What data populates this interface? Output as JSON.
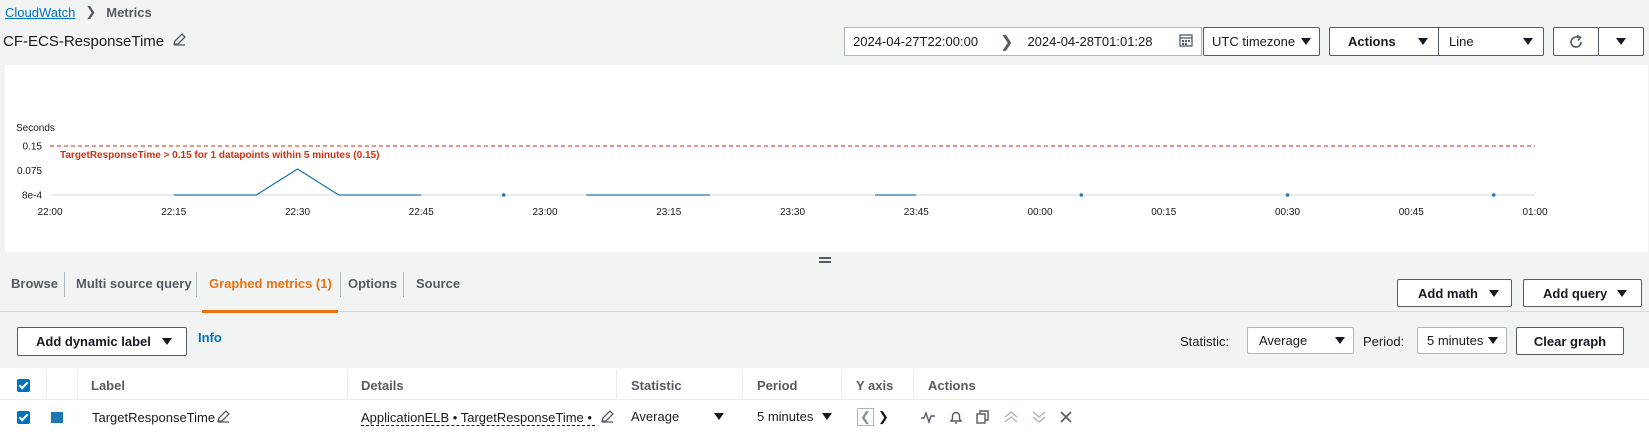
{
  "breadcrumb": {
    "root": "CloudWatch",
    "current": "Metrics"
  },
  "page_title": "CF-ECS-ResponseTime",
  "time_range": {
    "start": "2024-04-27T22:00:00",
    "end": "2024-04-28T01:01:28"
  },
  "toolbar": {
    "timezone": "UTC timezone",
    "actions": "Actions",
    "chart_type": "Line"
  },
  "chart_data": {
    "type": "line",
    "ylabel": "Seconds",
    "y_ticks": [
      "0.15",
      "0.075",
      "8e-4"
    ],
    "x_ticks": [
      "22:00",
      "22:15",
      "22:30",
      "22:45",
      "23:00",
      "23:15",
      "23:30",
      "23:45",
      "00:00",
      "00:15",
      "00:30",
      "00:45",
      "01:00"
    ],
    "threshold": {
      "value": 0.15,
      "label": "TargetResponseTime > 0.15 for 1 datapoints within 5 minutes (0.15)",
      "color": "#d13212"
    },
    "series": [
      {
        "name": "TargetResponseTime",
        "color": "#1f77b4",
        "segments": [
          [
            [
              "22:15",
              0.0008
            ],
            [
              "22:20",
              0.0008
            ],
            [
              "22:25",
              0.0008
            ],
            [
              "22:30",
              0.08
            ],
            [
              "22:35",
              0.0008
            ],
            [
              "22:40",
              0.0008
            ],
            [
              "22:45",
              0.0008
            ]
          ],
          [
            [
              "23:05",
              0.0008
            ],
            [
              "23:10",
              0.0008
            ],
            [
              "23:15",
              0.0008
            ],
            [
              "23:20",
              0.0008
            ]
          ],
          [
            [
              "23:40",
              0.0008
            ],
            [
              "23:45",
              0.0008
            ]
          ]
        ],
        "points": [
          [
            "22:55",
            0.0008
          ],
          [
            "00:05",
            0.0008
          ],
          [
            "00:30",
            0.0008
          ],
          [
            "00:55",
            0.0008
          ]
        ]
      }
    ]
  },
  "tabs": [
    "Browse",
    "Multi source query",
    "Graphed metrics (1)",
    "Options",
    "Source"
  ],
  "active_tab": "Graphed metrics (1)",
  "right_buttons": {
    "add_math": "Add math",
    "add_query": "Add query"
  },
  "controls": {
    "add_dynamic_label": "Add dynamic label",
    "info": "Info",
    "statistic_label": "Statistic:",
    "statistic_value": "Average",
    "period_label": "Period:",
    "period_value": "5 minutes",
    "clear_graph": "Clear graph"
  },
  "table": {
    "headers": {
      "label": "Label",
      "details": "Details",
      "statistic": "Statistic",
      "period": "Period",
      "y_axis": "Y axis",
      "actions": "Actions"
    },
    "rows": [
      {
        "label": "TargetResponseTime",
        "details": "ApplicationELB • TargetResponseTime • T",
        "statistic": "Average",
        "period": "5 minutes",
        "color": "#1f77b4"
      }
    ]
  }
}
